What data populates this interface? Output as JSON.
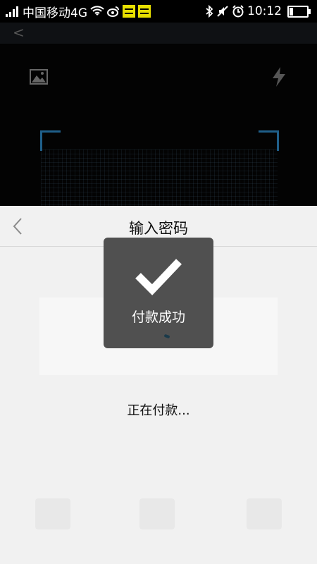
{
  "status_bar": {
    "carrier": "中国移动4G",
    "time": "10:12"
  },
  "sheet": {
    "title": "输入密码",
    "status_text": "正在付款..."
  },
  "toast": {
    "message": "付款成功"
  },
  "colors": {
    "scanner_corner": "#1f5f8a",
    "toast_bg": "#505050",
    "sheet_bg": "#f1f1f1"
  }
}
